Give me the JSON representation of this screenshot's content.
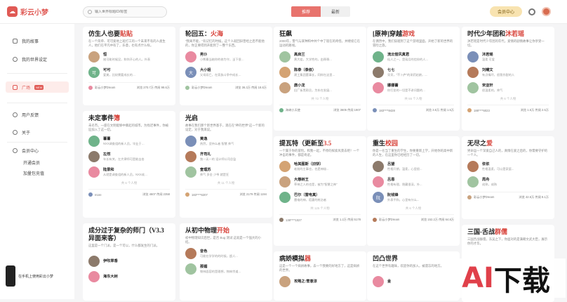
{
  "app": {
    "name": "彩云小梦"
  },
  "search": {
    "placeholder": "输入世界标题ID/标签"
  },
  "tabs": [
    {
      "label": "推荐"
    },
    {
      "label": "最新"
    }
  ],
  "header": {
    "member_label": "会员中心"
  },
  "sidebar": {
    "items": [
      {
        "label": "我的故事"
      },
      {
        "label": "我的世界设定"
      },
      {
        "label": "广场"
      },
      {
        "label": "用户反馈"
      },
      {
        "label": "关于"
      },
      {
        "label": "会员中心"
      }
    ],
    "new_badge": "NEW",
    "sub_items": [
      {
        "label": "开通会员"
      },
      {
        "label": "加量包充值"
      }
    ],
    "phone_label": "在手机上使用彩云小梦"
  },
  "cards": [
    {
      "title_pre": "仿生人也要",
      "title_hl": "贴贴",
      "desc": "在一个简单、可可爱地上班打工的一个未来不有的人类生人，他们在平凡中有了，乐意，也有点什么样。",
      "roles": [
        {
          "name": "恒",
          "desc": "她可能时候没，和你开心的人。外表",
          "av": ""
        },
        {
          "name": "可可",
          "desc": "爱美，比较需要成长的…",
          "av": "可"
        }
      ],
      "more": "",
      "author": "彩云小梦Dream",
      "stats": "浏览 270.7万  传阅 98.6万"
    },
    {
      "title_pre": "未定事件",
      "title_hl": "簿",
      "desc": "未名市。一座在文明能够中撕起的城市。为找迟事件，你被迫加入了这一切。",
      "roles": [
        {
          "name": "薯薯",
          "desc": "NXX调查组的新人员，毕业于…",
          "av": ""
        },
        {
          "name": "左然",
          "desc": "年长有关，左大律师可是能击各",
          "av": ""
        },
        {
          "name": "陆景和",
          "desc": "从就是调查组的新人员，NXX成…",
          "av": ""
        }
      ],
      "more": "共 6 个人物",
      "author": "more",
      "stats": "浏览 4607  传阅 2358"
    },
    {
      "title_pre": "成分过于复杂的师门（V3.3异面来客）",
      "title_hl": "",
      "desc": "这里是一个门派，是一个可以，什么都发生的门派。",
      "roles": [
        {
          "name": "伊吹翠香",
          "desc": "",
          "av": ""
        },
        {
          "name": "海东大树",
          "desc": "",
          "av": ""
        }
      ],
      "more": "",
      "author": "",
      "stats": ""
    },
    {
      "title_pre": "轮回五：",
      "title_hl": "火海",
      "desc": "\"我离不能，\"有记忆的时候，这个人就回旧曾经之后不能他的，你正要得到开能到了一整个东西。",
      "roles": [
        {
          "name": "男仆",
          "desc": "小熊最当她你的修为守，当下很…",
          "av": ""
        },
        {
          "name": "大小姐",
          "desc": "父母双亡，在家族斗争中成长…",
          "av": "大"
        }
      ],
      "more": "",
      "author": "彩云小梦Dream",
      "stats": "浏览 36.3万  传阅 18.8万"
    },
    {
      "title_pre": "光启",
      "title_hl": "",
      "desc": "故事在我们那个新世界基于，现在在\"神的世界\"这一个新的设定，对于我来说。",
      "roles": [
        {
          "name": "黄逸",
          "desc": "热烈，坚持么者 智慧 帅气",
          "av": ""
        },
        {
          "name": "齐司礼",
          "desc": "独一无一的 设计师公司总监",
          "av": ""
        },
        {
          "name": "查理苏",
          "desc": "帅气 多金 少爷 就是狂",
          "av": ""
        }
      ],
      "more": "共 11 个人物",
      "author": "183****6207",
      "stats": "浏览 2179  传阅 1194"
    },
    {
      "title_pre": "从初中物理",
      "title_hl": "开始",
      "desc": "初中物理知识后世，是否 Bug 测试 这就是一个强大的小结。",
      "roles": [
        {
          "name": "音色",
          "desc": "可能在学学的的时候，超人...",
          "av": ""
        },
        {
          "name": "那媚",
          "desc": "物林面容的是理想，物林宗道...",
          "av": ""
        }
      ],
      "more": "",
      "author": "",
      "stats": ""
    },
    {
      "title_pre": "狂飙",
      "title_hl": "",
      "desc": "2000年，警气与某种和中共个中了现在的奇怪，并继续它在运动的路线。",
      "roles": [
        {
          "name": "高启兰",
          "desc": "黄大姐，大学性的，由哥哥...",
          "av": ""
        },
        {
          "name": "陈泰（泰叔）",
          "desc": "建工集团董事长，同样在这里...",
          "av": ""
        },
        {
          "name": "唐小龙",
          "desc": "旧厂街黑帮员，为东在发展...",
          "av": ""
        }
      ],
      "more": "共 72 个人物",
      "author": "海峡小天使",
      "stats": "浏览 3605  传阅 1907"
    },
    {
      "title_pre": "提瓦特（更新至",
      "title_hl": "3.5",
      "desc": "一个属于你的冒险。和我一起，不停的探索风景去吧！一个冲击的事件，都是奇迹。",
      "roles": [
        {
          "name": "哈其图斯（旧饼）",
          "desc": "老前的主事也，也是神秘...",
          "av": ""
        },
        {
          "name": "大慈树王",
          "desc": "草神之人的也是，被为\"智慧之神\"",
          "av": ""
        },
        {
          "name": "巴尔（雷电真）",
          "desc": "雷电的神，稻妻的统治者",
          "av": ""
        }
      ],
      "more": "共 125 个人物",
      "author": "138****1027",
      "stats": "浏览 1.2万  传阅 5178"
    },
    {
      "title_pre": "病娇模拟",
      "title_hl": "器",
      "desc": "这是一个一个病娇故事，去一个我要的好地方了，这是病娇的世界。",
      "roles": [
        {
          "name": "攻略之:雪意淳",
          "desc": "",
          "av": ""
        }
      ],
      "more": "",
      "author": "",
      "stats": ""
    },
    {
      "title_pre": "[原神]穿越",
      "title_hl": "游戏",
      "desc": "在偶然中，我们穿越到了这个游戏里面，开始了新的世界的冒险之旅。",
      "roles": [
        {
          "name": "流云借风真君",
          "desc": "仙人之一，是璃月的信仰的人...",
          "av": ""
        },
        {
          "name": "七七",
          "desc": "呆呆，\"不卜庐\"的采药姑娘，...",
          "av": ""
        },
        {
          "name": "娜娜蕾",
          "desc": "你打坐的一切是不讲问题的...",
          "av": ""
        }
      ],
      "more": "共 55 个人物",
      "author": "183****8428",
      "stats": "浏览 3.5万  传阅 1.5万"
    },
    {
      "title_pre": "重生",
      "title_hl": "校园",
      "desc": "你是一名当了重生的学生，你要重新上学，开始你的高中新的人生，在这里你已经经历了一切。",
      "roles": [
        {
          "name": "吕望",
          "desc": "性格开朗，温柔，心里很...",
          "av": ""
        },
        {
          "name": "吕恩",
          "desc": "性格有理，隐藏很深，外...",
          "av": ""
        },
        {
          "name": "阮钱锋",
          "desc": "外表平和，心里有什么...",
          "av": "阮"
        }
      ],
      "more": "共 6 个人物",
      "author": "彩云小梦Dream",
      "stats": "浏览 152.2万  传阅 64.8万"
    },
    {
      "title_pre": "凹凸世界",
      "title_hl": "",
      "desc": "在这个世界有趣味，欢迎你的加入，被遗忘的地方。",
      "roles": [
        {
          "name": "金",
          "desc": "",
          "av": ""
        }
      ],
      "more": "",
      "author": "",
      "stats": ""
    },
    {
      "title_pre": "时代少年团和",
      "title_hl": "沐若瑶",
      "desc": "沐若瑶是时代少年团的年代，爱情的剧情故事让你享受一切。",
      "roles": [
        {
          "name": "沐若瑶",
          "desc": "温柔 可爱",
          "av": ""
        },
        {
          "name": "刘耀文",
          "desc": "有点嘴坏，很我作甜的人",
          "av": ""
        },
        {
          "name": "宋亚轩",
          "desc": "很温柔的，帅气",
          "av": ""
        }
      ],
      "more": "共 6 个人物",
      "author": "188****6023",
      "stats": "浏览 1.5万  传阅 2.5万"
    },
    {
      "title_pre": "无尽之",
      "title_hl": "爱",
      "desc": "男命运一个深爱自己人的，真情在爱之后的，你需要守护的一个人。",
      "roles": [
        {
          "name": "依依",
          "desc": "性格温柔，可以是家庭...",
          "av": ""
        },
        {
          "name": "周舟",
          "desc": "成熟，成熟",
          "av": ""
        }
      ],
      "more": "",
      "author": "彩云小梦Dream",
      "stats": "浏览 42.6万  传阅 8.1万"
    },
    {
      "title_pre": "三国-舌战",
      "title_hl": "群儒",
      "desc": "三国舌战群儒，东吴之下，你面对的是满朝文武大臣，展示你的才华。",
      "roles": [],
      "more": "",
      "author": "",
      "stats": ""
    }
  ],
  "watermark": {
    "a": "AI",
    "rest": "下载"
  },
  "colors": {
    "accent": "#e05a55",
    "gold": "#f8e3b0"
  }
}
